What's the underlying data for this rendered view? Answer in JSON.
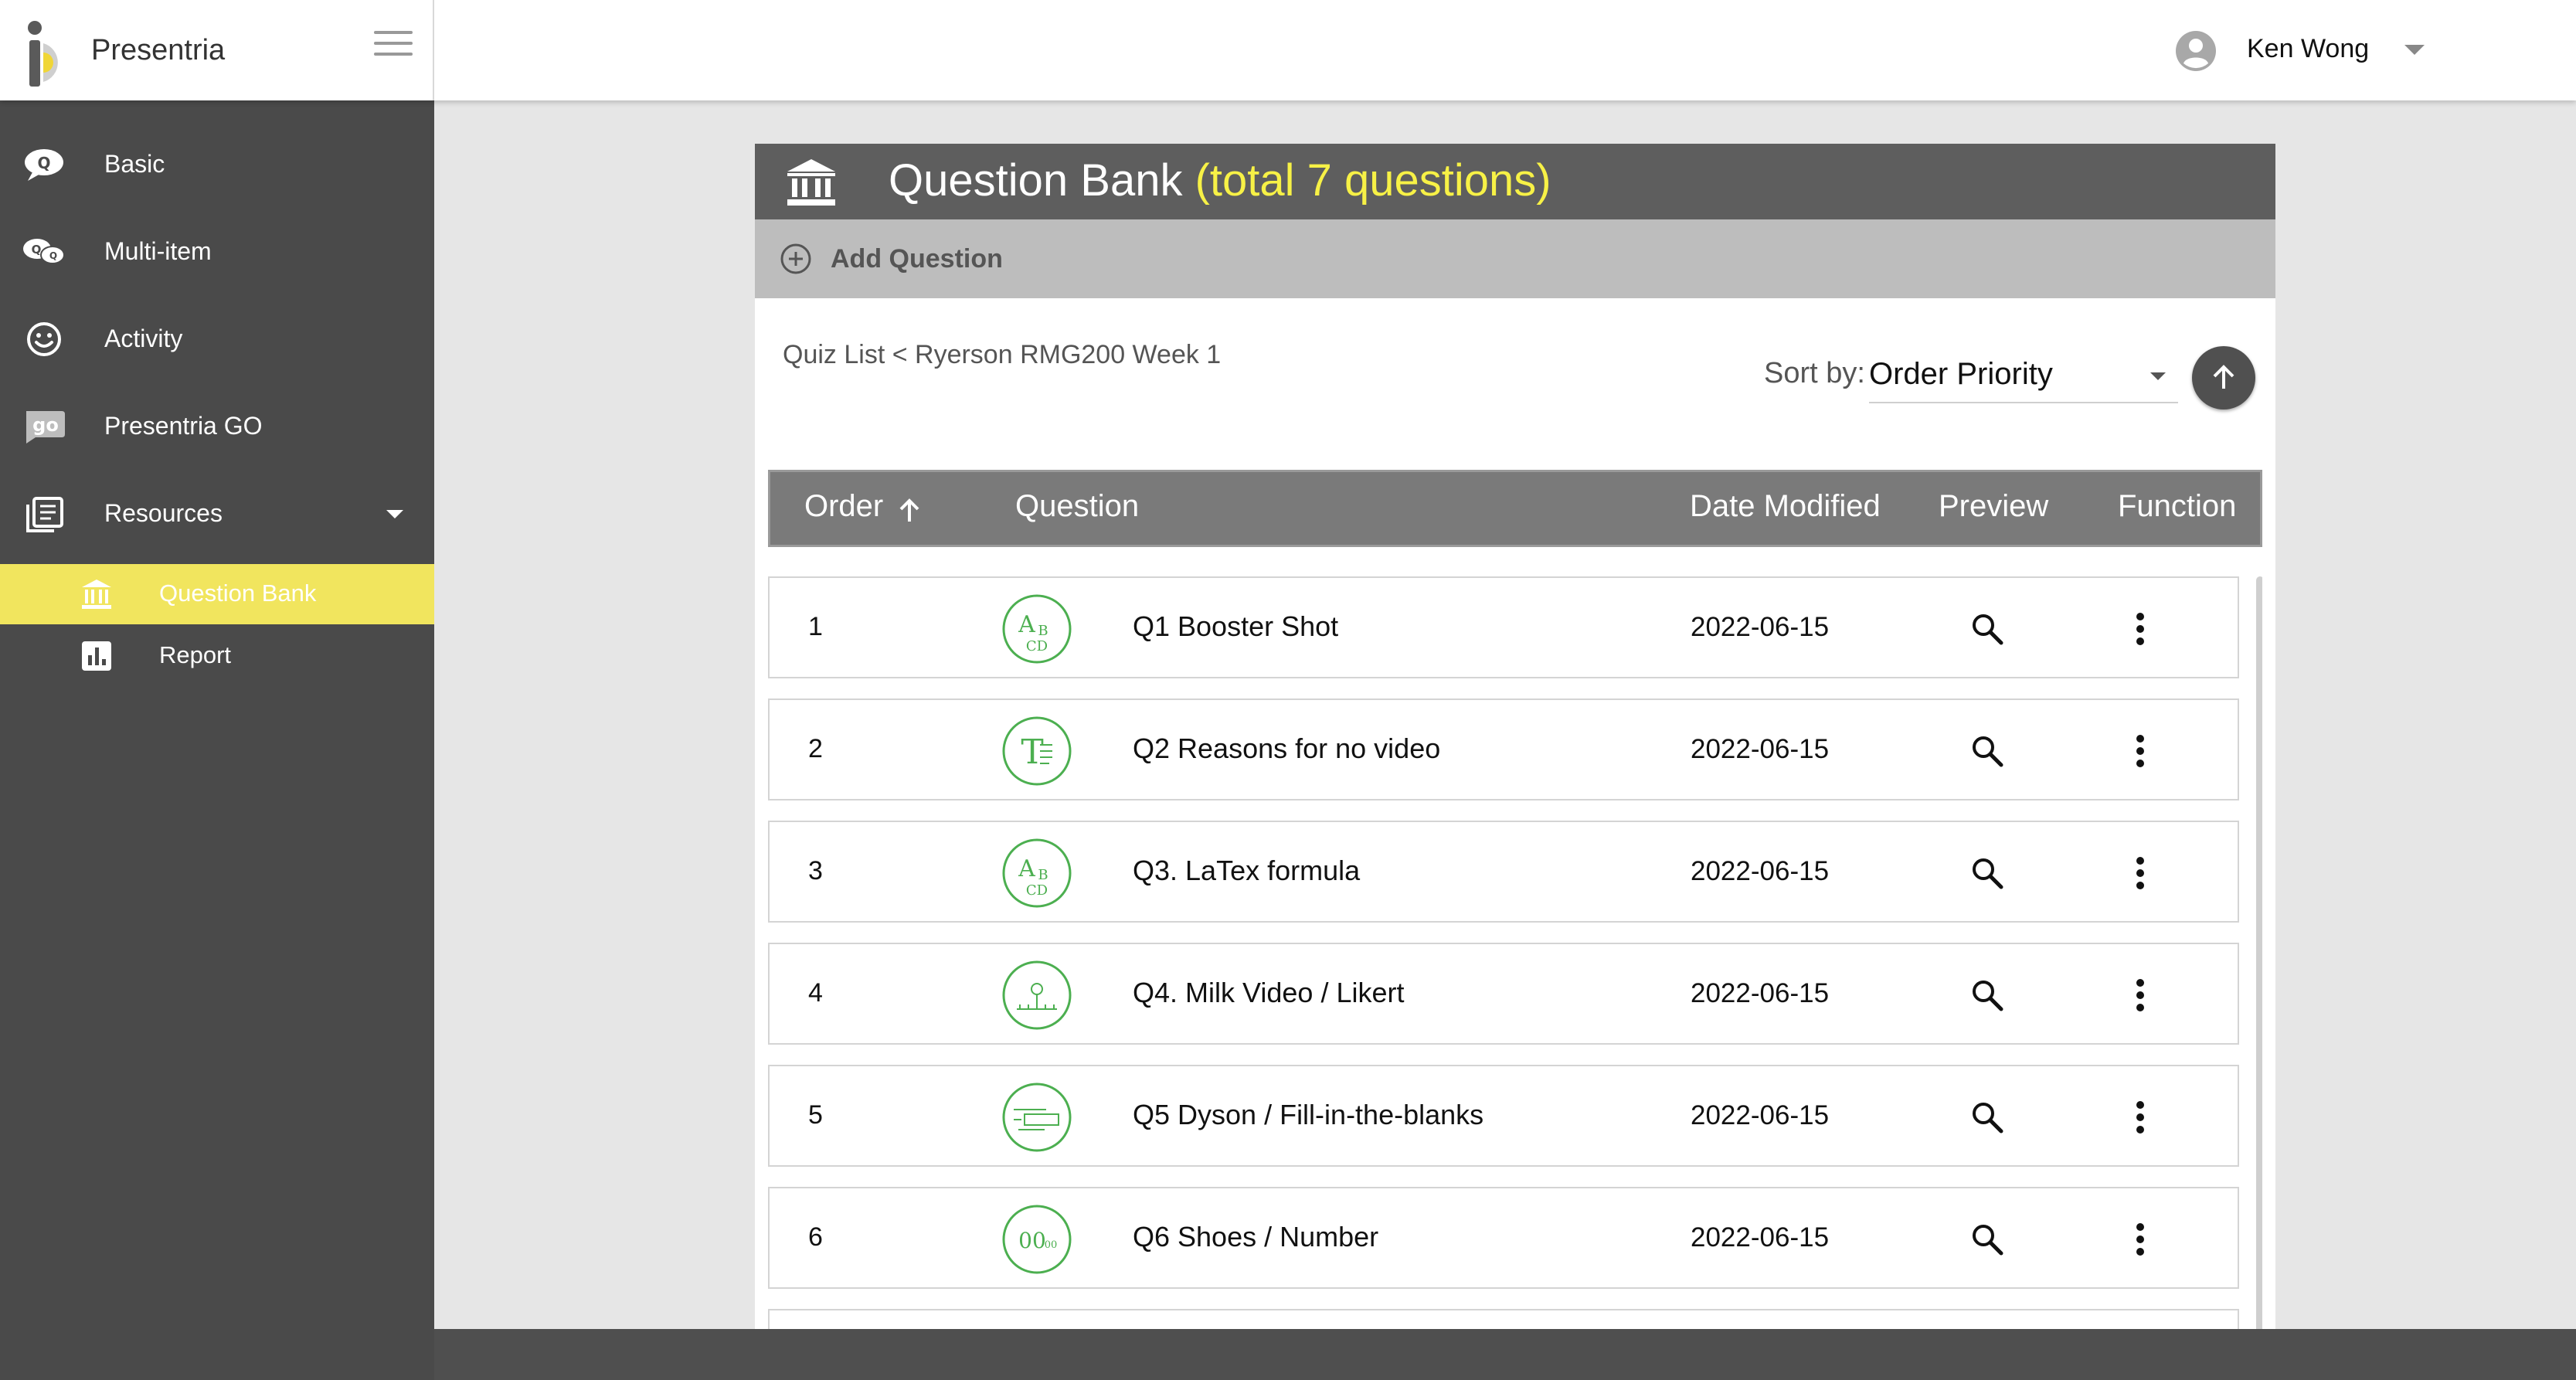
{
  "app": {
    "brand": "Presentria"
  },
  "user": {
    "name": "Ken Wong"
  },
  "sidebar": {
    "items": [
      {
        "label": "Basic"
      },
      {
        "label": "Multi-item"
      },
      {
        "label": "Activity"
      },
      {
        "label": "Presentria GO"
      },
      {
        "label": "Resources"
      }
    ],
    "sub_items": [
      {
        "label": "Question Bank",
        "active": true
      },
      {
        "label": "Report"
      }
    ]
  },
  "panel": {
    "title": "Question Bank",
    "count_text": "(total 7 questions)",
    "add_label": "Add Question",
    "breadcrumb_root": "Quiz List",
    "breadcrumb_sep": " < ",
    "breadcrumb_current": "Ryerson RMG200 Week 1",
    "sort_label": "Sort by:",
    "sort_value": "Order Priority"
  },
  "table": {
    "headers": {
      "order": "Order",
      "question": "Question",
      "date": "Date Modified",
      "preview": "Preview",
      "function": "Function"
    },
    "rows": [
      {
        "order": "1",
        "title": "Q1 Booster Shot",
        "date": "2022-06-15",
        "type": "multiple-choice-icon"
      },
      {
        "order": "2",
        "title": "Q2 Reasons for no video",
        "date": "2022-06-15",
        "type": "text-answer-icon"
      },
      {
        "order": "3",
        "title": "Q3. LaTex formula",
        "date": "2022-06-15",
        "type": "multiple-choice-icon"
      },
      {
        "order": "4",
        "title": "Q4. Milk Video / Likert",
        "date": "2022-06-15",
        "type": "likert-scale-icon"
      },
      {
        "order": "5",
        "title": "Q5 Dyson / Fill-in-the-blanks",
        "date": "2022-06-15",
        "type": "fill-in-blanks-icon"
      },
      {
        "order": "6",
        "title": "Q6 Shoes / Number",
        "date": "2022-06-15",
        "type": "number-answer-icon"
      }
    ]
  },
  "colors": {
    "sidebar": "#4a4a4a",
    "active": "#f1e55e",
    "highlight": "#f7f146",
    "icon_green": "#4caf50"
  }
}
